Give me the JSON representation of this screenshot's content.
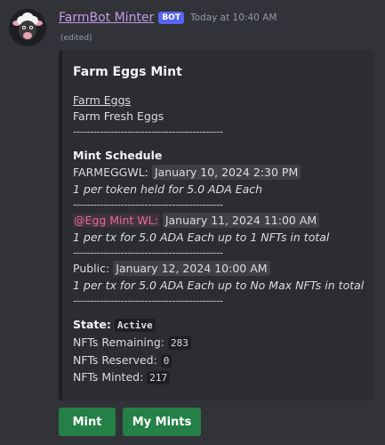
{
  "message": {
    "author": "FarmBot Minter",
    "bot_tag": "BOT",
    "timestamp": "Today at 10:40 AM",
    "edited": "(edited)"
  },
  "embed": {
    "title": "Farm Eggs Mint",
    "collection_link": "Farm Eggs",
    "collection_desc": "Farm Fresh Eggs",
    "divider": "--------------------------------------------",
    "schedule_heading": "Mint Schedule",
    "phases": [
      {
        "label": "FARMEGGWL:",
        "date": "January 10, 2024 2:30 PM",
        "terms": "1 per token held for 5.0 ADA Each"
      },
      {
        "label": "@Egg Mint WL:",
        "date": "January 11, 2024 11:00 AM",
        "terms": "1 per tx for 5.0 ADA Each up to 1 NFTs in total"
      },
      {
        "label": "Public:",
        "date": "January 12, 2024 10:00 AM",
        "terms": "1 per tx for 5.0 ADA Each up to No Max NFTs in total"
      }
    ],
    "state_label": "State:",
    "state_value": "Active",
    "remaining_label": "NFTs Remaining:",
    "remaining_value": "283",
    "reserved_label": "NFTs Reserved:",
    "reserved_value": "0",
    "minted_label": "NFTs Minted:",
    "minted_value": "217"
  },
  "buttons": {
    "mint": "Mint",
    "my_mints": "My Mints"
  },
  "colors": {
    "background": "#313338",
    "embed_bg": "#2b2d31",
    "author": "#c69be9",
    "bot_tag": "#5865f2",
    "button": "#248046",
    "mention": "#e8689a"
  }
}
